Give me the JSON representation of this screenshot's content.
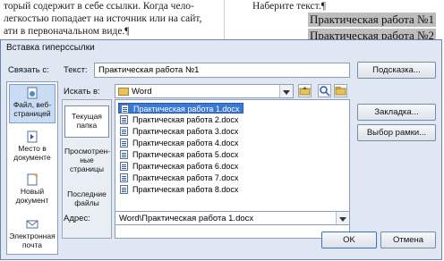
{
  "document": {
    "line1": "торый содержит в себе ссылки. Когда чело-",
    "line2": "легкостью попадает на источник или на сайт,",
    "line3": "ати в первоначальном виде.¶",
    "right_prompt": "Наберите текст.¶",
    "right_hl1": "Практическая работа №1",
    "right_hl2": "Практическая работа №2"
  },
  "dialog": {
    "title": "Вставка гиперссылки",
    "link_to_label": "Связать с:",
    "text_label": "Текст:",
    "text_value": "Практическая работа №1",
    "look_in_label": "Искать в:",
    "look_in_value": "Word",
    "address_label": "Адрес:",
    "address_value": "Word\\Практическая работа 1.docx",
    "link_targets": [
      {
        "label": "Файл, веб-страницей",
        "icon": "web-page-icon"
      },
      {
        "label": "Место в документе",
        "icon": "place-in-document-icon"
      },
      {
        "label": "Новый документ",
        "icon": "new-document-icon"
      },
      {
        "label": "Электронная почта",
        "icon": "email-icon"
      }
    ],
    "look_tabs": [
      {
        "label": "Текущая папка"
      },
      {
        "label": "Просмотрен-ные страницы"
      },
      {
        "label": "Последние файлы"
      }
    ],
    "files": [
      "Практическая работа 1.docx",
      "Практическая работа 2.docx",
      "Практическая работа 3.docx",
      "Практическая работа 4.docx",
      "Практическая работа 5.docx",
      "Практическая работа 6.docx",
      "Практическая работа 7.docx",
      "Практическая работа 8.docx"
    ],
    "buttons": {
      "screentip": "Подсказка...",
      "bookmark": "Закладка...",
      "target_frame": "Выбор рамки...",
      "ok": "OK",
      "cancel": "Отмена"
    },
    "colors": {
      "selection": "#3a78d6",
      "dialog_bg": "#dfe7f3"
    }
  }
}
